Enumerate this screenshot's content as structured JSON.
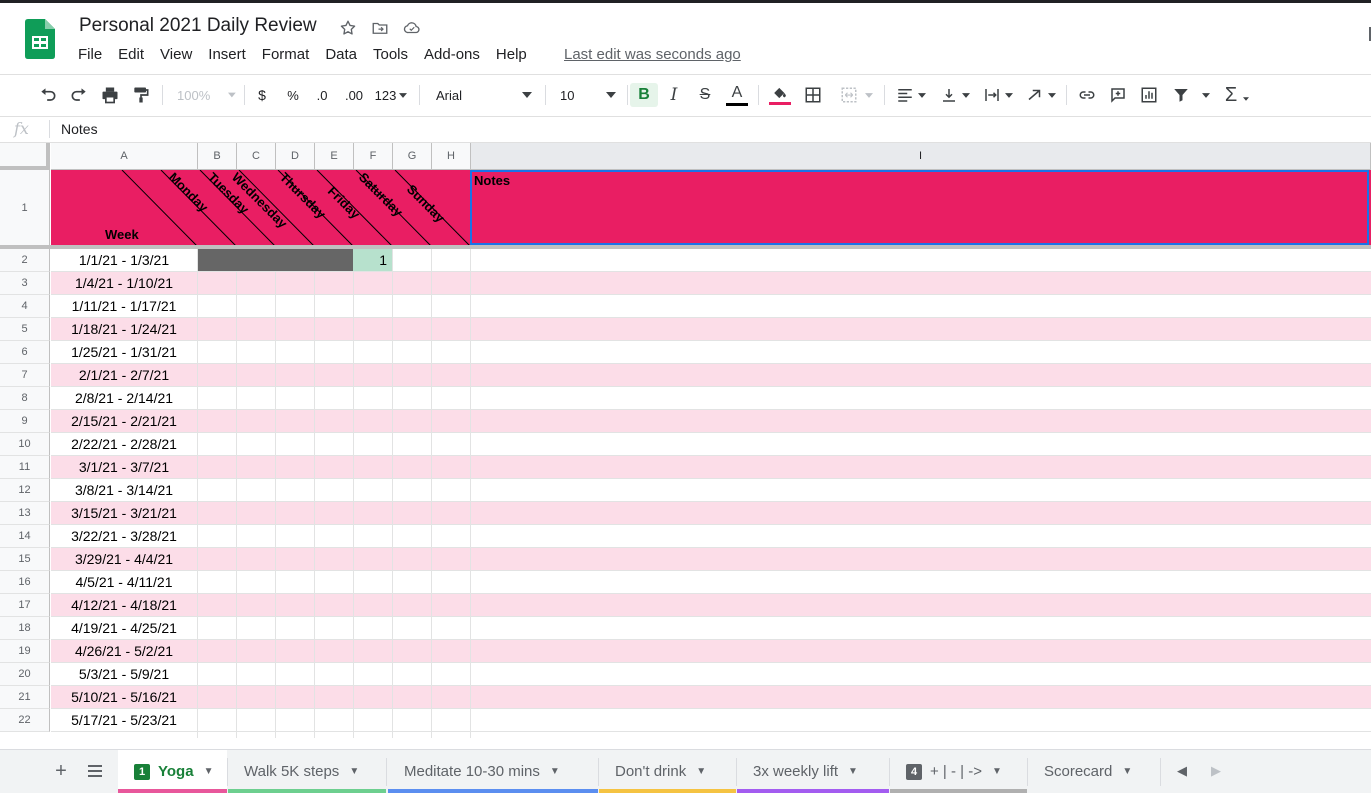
{
  "app": {
    "title": "Personal 2021 Daily Review",
    "last_edit": "Last edit was seconds ago",
    "menu": [
      "File",
      "Edit",
      "View",
      "Insert",
      "Format",
      "Data",
      "Tools",
      "Add-ons",
      "Help"
    ]
  },
  "toolbar": {
    "zoom": "100%",
    "currency": "$",
    "percent": "%",
    "decrease_decimals": ".0",
    "increase_decimals": ".00",
    "more_formats": "123",
    "font": "Arial",
    "font_size": "10",
    "bold": "B",
    "italic": "I",
    "strikethrough": "S",
    "text_color": "A"
  },
  "formula_bar": {
    "fx": "fx",
    "value": "Notes"
  },
  "columns": [
    "A",
    "B",
    "C",
    "D",
    "E",
    "F",
    "G",
    "H",
    "I"
  ],
  "header": {
    "row_number": "1",
    "week": "Week",
    "days": [
      "Monday",
      "Tuesday",
      "Wednesday",
      "Thursday",
      "Friday",
      "Saturday",
      "Sunday"
    ],
    "notes": "Notes",
    "fill_color": "#e91e63"
  },
  "rows": [
    {
      "n": "2",
      "week": "1/1/21 - 1/3/21",
      "saturday": "1"
    },
    {
      "n": "3",
      "week": "1/4/21 - 1/10/21"
    },
    {
      "n": "4",
      "week": "1/11/21 - 1/17/21"
    },
    {
      "n": "5",
      "week": "1/18/21 - 1/24/21"
    },
    {
      "n": "6",
      "week": "1/25/21 - 1/31/21"
    },
    {
      "n": "7",
      "week": "2/1/21 - 2/7/21"
    },
    {
      "n": "8",
      "week": "2/8/21 - 2/14/21"
    },
    {
      "n": "9",
      "week": "2/15/21 - 2/21/21"
    },
    {
      "n": "10",
      "week": "2/22/21 - 2/28/21"
    },
    {
      "n": "11",
      "week": "3/1/21 - 3/7/21"
    },
    {
      "n": "12",
      "week": "3/8/21 - 3/14/21"
    },
    {
      "n": "13",
      "week": "3/15/21 - 3/21/21"
    },
    {
      "n": "14",
      "week": "3/22/21 - 3/28/21"
    },
    {
      "n": "15",
      "week": "3/29/21 - 4/4/21"
    },
    {
      "n": "16",
      "week": "4/5/21 - 4/11/21"
    },
    {
      "n": "17",
      "week": "4/12/21 - 4/18/21"
    },
    {
      "n": "18",
      "week": "4/19/21 - 4/25/21"
    },
    {
      "n": "19",
      "week": "4/26/21 - 5/2/21"
    },
    {
      "n": "20",
      "week": "5/3/21 - 5/9/21"
    },
    {
      "n": "21",
      "week": "5/10/21 - 5/16/21"
    },
    {
      "n": "22",
      "week": "5/17/21 - 5/23/21"
    }
  ],
  "colors": {
    "band_pink": "#fcdde8",
    "disabled_fill": "#666666",
    "done_fill": "#b7e1cd",
    "selection": "#1a73e8"
  },
  "sheets": [
    {
      "label": "Yoga",
      "badge": "1",
      "active": true,
      "color": "#e8579b"
    },
    {
      "label": "Walk 5K steps",
      "color": "#6dcf8f"
    },
    {
      "label": "Meditate 10-30 mins",
      "color": "#5b8ef0"
    },
    {
      "label": "Don't drink",
      "color": "#f5c342"
    },
    {
      "label": "3x weekly lift",
      "color": "#a35cf0"
    },
    {
      "label": "+ | - | ->",
      "badge": "4",
      "color": "#b0b0b0"
    },
    {
      "label": "Scorecard",
      "color": ""
    }
  ]
}
